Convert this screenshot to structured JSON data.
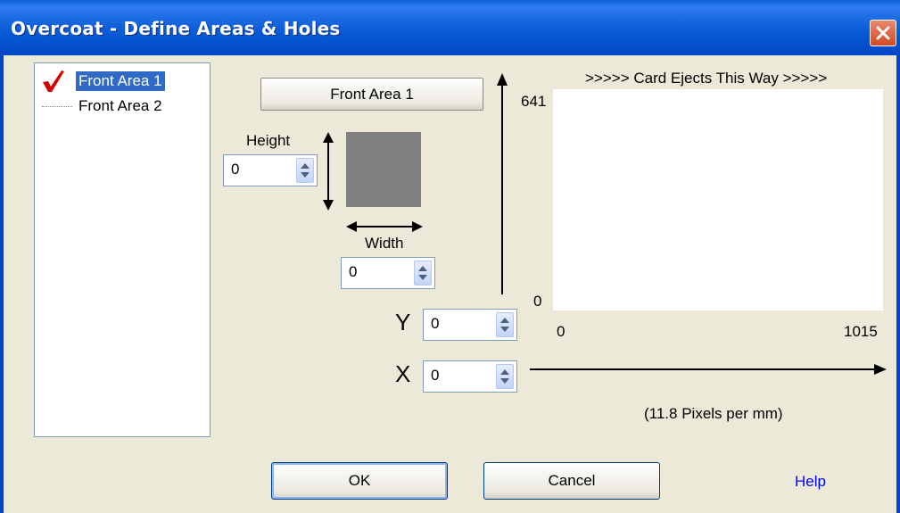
{
  "window": {
    "title": "Overcoat - Define Areas & Holes",
    "close_icon": "close-icon"
  },
  "tree": {
    "items": [
      {
        "label": "Front Area 1",
        "selected": true,
        "icon": "checkmark-icon"
      },
      {
        "label": "Front Area 2",
        "selected": false
      }
    ]
  },
  "area_button": {
    "label": "Front Area 1"
  },
  "height": {
    "label": "Height",
    "value": "0"
  },
  "width": {
    "label": "Width",
    "value": "0"
  },
  "y": {
    "label": "Y",
    "value": "0"
  },
  "x": {
    "label": "X",
    "value": "0"
  },
  "card": {
    "eject_label": ">>>>> Card Ejects This Way >>>>>",
    "y_max": "641",
    "y_min": "0",
    "x_min": "0",
    "x_max": "1015",
    "scale_note": "(11.8 Pixels per mm)"
  },
  "buttons": {
    "ok": "OK",
    "cancel": "Cancel",
    "help": "Help"
  },
  "colors": {
    "titlebar": "#0a5cd6",
    "selection": "#316ac5",
    "checkmark": "#d40000",
    "help_link": "#0000ff"
  }
}
